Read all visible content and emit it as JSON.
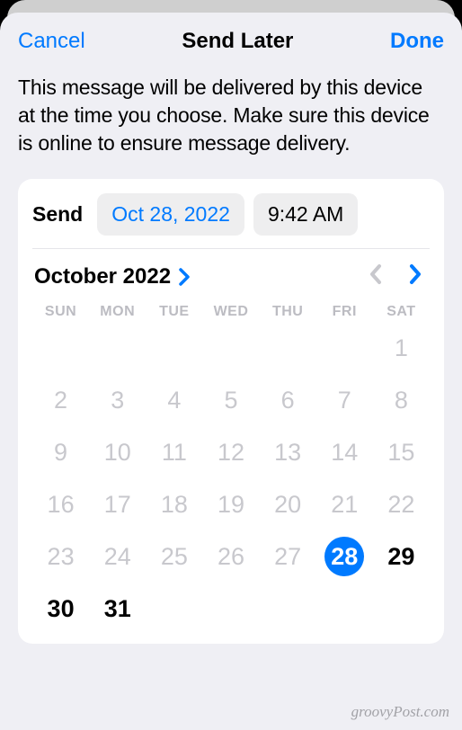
{
  "nav": {
    "cancel": "Cancel",
    "title": "Send Later",
    "done": "Done"
  },
  "description": "This message will be delivered by this device at the time you choose. Make sure this device is online to ensure message delivery.",
  "send": {
    "label": "Send",
    "date": "Oct 28, 2022",
    "time": "9:42 AM"
  },
  "calendar": {
    "month_label": "October 2022",
    "weekdays": [
      "SUN",
      "MON",
      "TUE",
      "WED",
      "THU",
      "FRI",
      "SAT"
    ],
    "selected_day": 28,
    "grid": [
      {
        "n": "",
        "active": false
      },
      {
        "n": "",
        "active": false
      },
      {
        "n": "",
        "active": false
      },
      {
        "n": "",
        "active": false
      },
      {
        "n": "",
        "active": false
      },
      {
        "n": "",
        "active": false
      },
      {
        "n": "1",
        "active": false
      },
      {
        "n": "2",
        "active": false
      },
      {
        "n": "3",
        "active": false
      },
      {
        "n": "4",
        "active": false
      },
      {
        "n": "5",
        "active": false
      },
      {
        "n": "6",
        "active": false
      },
      {
        "n": "7",
        "active": false
      },
      {
        "n": "8",
        "active": false
      },
      {
        "n": "9",
        "active": false
      },
      {
        "n": "10",
        "active": false
      },
      {
        "n": "11",
        "active": false
      },
      {
        "n": "12",
        "active": false
      },
      {
        "n": "13",
        "active": false
      },
      {
        "n": "14",
        "active": false
      },
      {
        "n": "15",
        "active": false
      },
      {
        "n": "16",
        "active": false
      },
      {
        "n": "17",
        "active": false
      },
      {
        "n": "18",
        "active": false
      },
      {
        "n": "19",
        "active": false
      },
      {
        "n": "20",
        "active": false
      },
      {
        "n": "21",
        "active": false
      },
      {
        "n": "22",
        "active": false
      },
      {
        "n": "23",
        "active": false
      },
      {
        "n": "24",
        "active": false
      },
      {
        "n": "25",
        "active": false
      },
      {
        "n": "26",
        "active": false
      },
      {
        "n": "27",
        "active": false
      },
      {
        "n": "28",
        "active": true,
        "selected": true
      },
      {
        "n": "29",
        "active": true
      },
      {
        "n": "30",
        "active": true
      },
      {
        "n": "31",
        "active": true
      }
    ]
  },
  "watermark": "groovyPost.com"
}
